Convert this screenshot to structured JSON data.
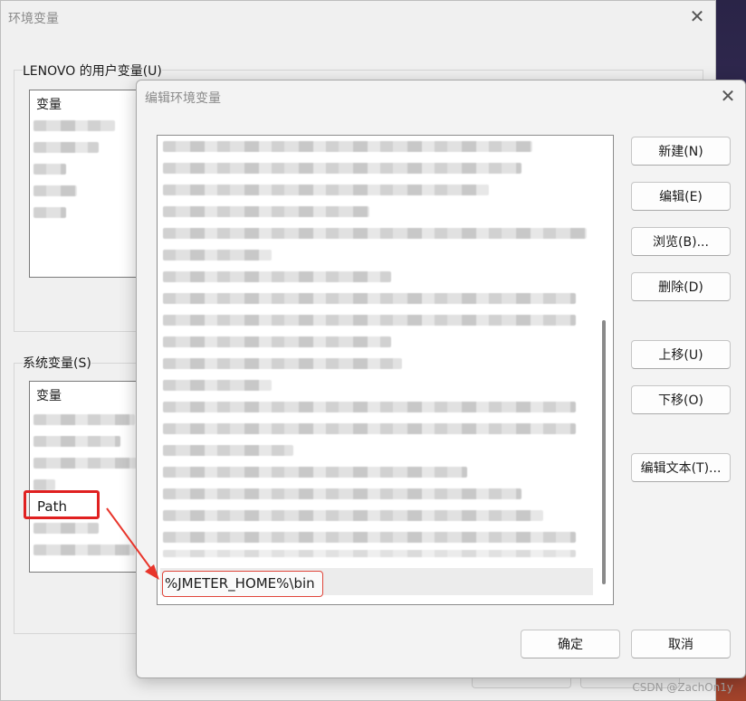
{
  "env_window": {
    "title": "环境变量",
    "user_group_label": "LENOVO 的用户变量(U)",
    "user_list_header": "变量",
    "system_group_label": "系统变量(S)",
    "system_list_header": "变量",
    "highlighted_variable": "Path"
  },
  "edit_window": {
    "title": "编辑环境变量",
    "new_entry_value": "%JMETER_HOME%\\bin",
    "buttons": {
      "new": "新建(N)",
      "edit": "编辑(E)",
      "browse": "浏览(B)...",
      "delete": "删除(D)",
      "move_up": "上移(U)",
      "move_down": "下移(O)",
      "edit_text": "编辑文本(T)...",
      "ok": "确定",
      "cancel": "取消"
    }
  },
  "watermark": "CSDN @ZachOn1y",
  "colors": {
    "highlight_red": "#e02020",
    "arrow_red": "#e8352b"
  },
  "icons": {
    "close": "close-icon",
    "arrow": "pointer-arrow"
  }
}
